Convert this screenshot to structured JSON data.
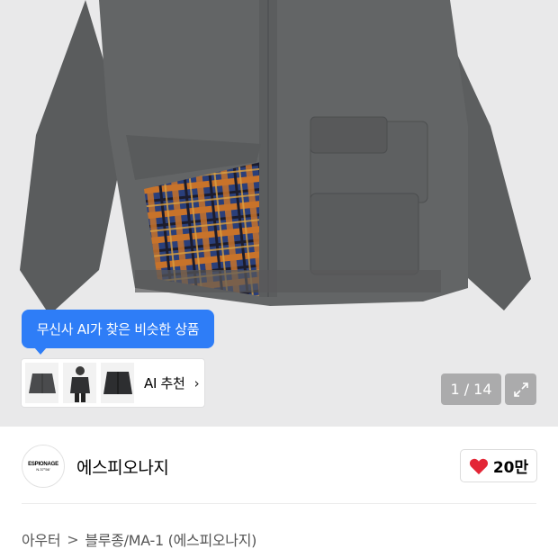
{
  "gallery": {
    "ai_tooltip": "무신사 AI가 찾은 비슷한 상품",
    "ai_recommend_label": "AI 추천",
    "ai_chevron": "›",
    "counter": "1 / 14",
    "thumbnails": [
      {
        "icon": "jacket-thumb-icon"
      },
      {
        "icon": "model-thumb-icon"
      },
      {
        "icon": "jacket-dark-thumb-icon"
      }
    ]
  },
  "brand": {
    "logo_line1": "ESPIONAGE",
    "logo_line2": "N.37°56'",
    "name": "에스피오나지",
    "like_count": "20만",
    "like_icon": "heart-icon",
    "like_color": "#e32636"
  },
  "breadcrumb": {
    "items": [
      "아우터",
      "블루종/MA-1 (에스피오나지)"
    ],
    "separator": ">"
  },
  "colors": {
    "accent": "#2e7df7",
    "background_gray": "#e9e9ea"
  }
}
